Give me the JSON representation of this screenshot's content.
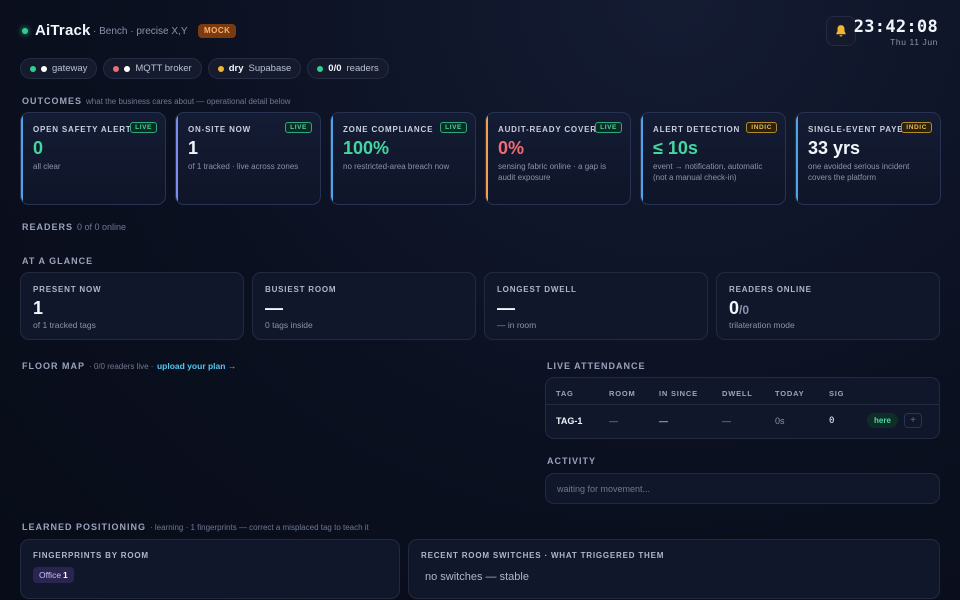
{
  "header": {
    "brand": "AiTrack",
    "subtitle": "· Bench · precise X,Y",
    "mode_badge": "MOCK",
    "clock": "23:42:08",
    "date": "Thu 11 Jun"
  },
  "status_pills": [
    {
      "label": "gateway",
      "dots": [
        "#2ecf8f",
        "#ffffff"
      ]
    },
    {
      "label": "MQTT broker",
      "dots": [
        "#f06b74",
        "#ffffff"
      ]
    },
    {
      "bold": "dry",
      "label": "Supabase",
      "dots": [
        "#f2b632"
      ]
    },
    {
      "bold": "0/0",
      "label": "readers",
      "dots": [
        "#2ecf8f"
      ]
    }
  ],
  "outcomes": {
    "title": "OUTCOMES",
    "subtitle": "what the business cares about — operational detail below",
    "cards": [
      {
        "label": "OPEN SAFETY ALERTS",
        "tag": "LIVE",
        "tag_type": "live",
        "value": "0",
        "desc": "all clear",
        "accent": "#4fa3e8",
        "value_color": "#45d6a0"
      },
      {
        "label": "ON-SITE NOW",
        "tag": "LIVE",
        "tag_type": "live",
        "value": "1",
        "desc": "of 1 tracked · live across zones",
        "accent": "#7c8cf0",
        "value_color": "#f2f5fb"
      },
      {
        "label": "ZONE COMPLIANCE",
        "tag": "LIVE",
        "tag_type": "live",
        "value": "100%",
        "desc": "no restricted-area breach now",
        "accent": "#4fa3e8",
        "value_color": "#45d6a0"
      },
      {
        "label": "AUDIT-READY COVERAGE",
        "tag": "LIVE",
        "tag_type": "live",
        "value": "0%",
        "desc": "sensing fabric online · a gap is audit exposure",
        "accent": "#f0a050",
        "value_color": "#f06b74"
      },
      {
        "label": "ALERT DETECTION",
        "tag": "INDIC",
        "tag_type": "indic",
        "value": "≤ 10s",
        "desc": "event → notification, automatic (not a manual check-in)",
        "accent": "#4fa3e8",
        "value_color": "#45d6a0"
      },
      {
        "label": "SINGLE-EVENT PAYBACK",
        "tag": "INDIC",
        "tag_type": "indic",
        "value": "33 yrs",
        "desc": "one avoided serious incident covers the platform",
        "accent": "#4fa3e8",
        "value_color": "#f2f5fb"
      }
    ]
  },
  "readers": {
    "title": "READERS",
    "subtitle": "0 of 0 online"
  },
  "glance": {
    "title": "AT A GLANCE",
    "cards": [
      {
        "label": "PRESENT NOW",
        "value": "1",
        "suffix": "",
        "desc": "of 1 tracked tags"
      },
      {
        "label": "BUSIEST ROOM",
        "value": "—",
        "suffix": "",
        "desc": "0 tags inside"
      },
      {
        "label": "LONGEST DWELL",
        "value": "—",
        "suffix": "",
        "desc": "— in room"
      },
      {
        "label": "READERS ONLINE",
        "value": "0",
        "suffix": "/0",
        "desc": "trilateration mode"
      }
    ]
  },
  "floor_map": {
    "title": "FLOOR MAP",
    "subtitle": "· 0/0 readers live ·",
    "link": "upload your plan →"
  },
  "attendance": {
    "title": "LIVE ATTENDANCE",
    "columns": [
      "TAG",
      "ROOM",
      "IN SINCE",
      "DWELL",
      "TODAY",
      "SIG"
    ],
    "rows": [
      {
        "tag": "TAG-1",
        "room": "—",
        "in_since": "—",
        "dwell": "—",
        "today": "0s",
        "sig": "0",
        "status": "here",
        "action": "+"
      }
    ]
  },
  "activity": {
    "title": "ACTIVITY",
    "placeholder": "waiting for movement..."
  },
  "learned": {
    "title": "LEARNED POSITIONING",
    "subtitle": "· learning · 1 fingerprints — correct a misplaced tag to teach it",
    "fingerprints_label": "FINGERPRINTS BY ROOM",
    "chip_room": "Office",
    "chip_count": "1",
    "switches_label": "RECENT ROOM SWITCHES · WHAT TRIGGERED THEM",
    "switches_text": "no switches — stable"
  }
}
